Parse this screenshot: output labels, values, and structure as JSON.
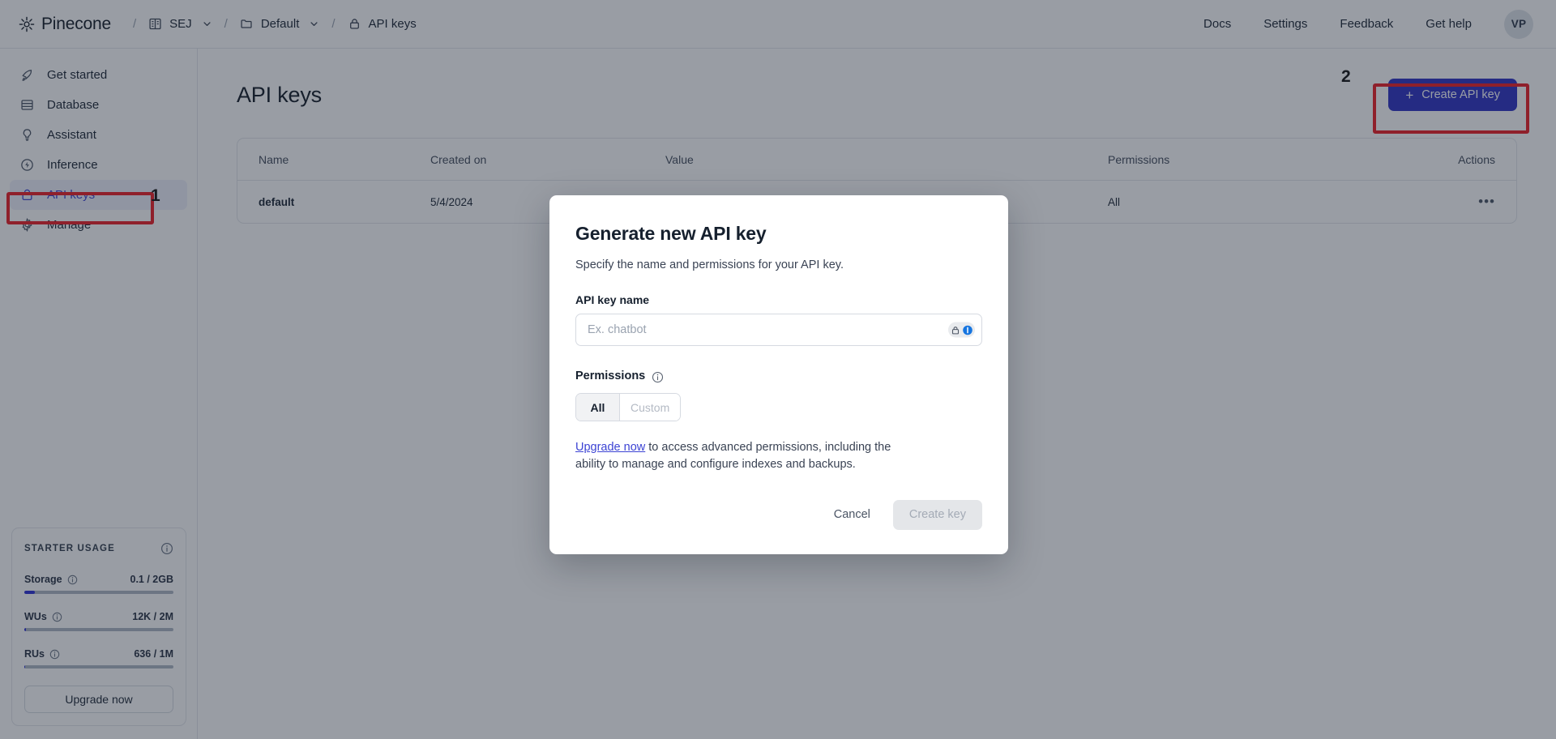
{
  "brand": {
    "name": "Pinecone",
    "logo_icon": "pinecone-logo-icon"
  },
  "breadcrumb": {
    "separator": "/",
    "items": [
      {
        "label": "SEJ",
        "icon": "organization-icon",
        "has_caret": true
      },
      {
        "label": "Default",
        "icon": "folder-icon",
        "has_caret": true
      },
      {
        "label": "API keys",
        "icon": "lock-icon",
        "has_caret": false
      }
    ]
  },
  "top_nav": {
    "links": [
      "Docs",
      "Settings",
      "Feedback",
      "Get help"
    ],
    "avatar_initials": "VP"
  },
  "sidebar": {
    "items": [
      {
        "label": "Get started",
        "icon": "rocket-icon",
        "active": false
      },
      {
        "label": "Database",
        "icon": "database-icon",
        "active": false
      },
      {
        "label": "Assistant",
        "icon": "lightbulb-icon",
        "active": false
      },
      {
        "label": "Inference",
        "icon": "bolt-circle-icon",
        "active": false
      },
      {
        "label": "API keys",
        "icon": "lock-icon",
        "active": true
      },
      {
        "label": "Manage",
        "icon": "gear-icon",
        "active": false
      }
    ],
    "usage": {
      "title": "STARTER USAGE",
      "info_icon": "info-icon",
      "metrics": [
        {
          "label": "Storage",
          "value": "0.1 / 2GB",
          "percent": 7
        },
        {
          "label": "WUs",
          "value": "12K / 2M",
          "percent": 1
        },
        {
          "label": "RUs",
          "value": "636 / 1M",
          "percent": 0.2
        }
      ],
      "upgrade_label": "Upgrade now"
    }
  },
  "main": {
    "title": "API keys",
    "create_button": {
      "label": "Create API key",
      "icon": "plus-icon"
    },
    "table": {
      "columns": [
        "Name",
        "Created on",
        "Value",
        "Permissions",
        "Actions"
      ],
      "rows": [
        {
          "name": "default",
          "created_on": "5/4/2024",
          "value": "",
          "permissions": "All",
          "actions": "•••"
        }
      ]
    }
  },
  "annotations": [
    {
      "number": "1",
      "target": "sidebar-item-api-keys"
    },
    {
      "number": "2",
      "target": "create-api-key-button"
    }
  ],
  "modal": {
    "title": "Generate new API key",
    "subtitle": "Specify the name and permissions for your API key.",
    "name_field": {
      "label": "API key name",
      "placeholder": "Ex. chatbot",
      "value": "",
      "badge_icons": [
        "password-lock-icon",
        "password-manager-icon"
      ]
    },
    "permissions": {
      "label": "Permissions",
      "info_icon": "info-icon",
      "options": [
        "All",
        "Custom"
      ],
      "selected": "All"
    },
    "upgrade_note": {
      "link_text": "Upgrade now",
      "rest_text": " to access advanced permissions, including the ability to manage and configure indexes and backups."
    },
    "actions": {
      "cancel_label": "Cancel",
      "submit_label": "Create key",
      "submit_disabled": true
    }
  },
  "colors": {
    "brand_primary": "#2d31c4",
    "accent_link": "#3c43d4",
    "annotation_red": "#ed1c24",
    "progress_fill": "#2b2fd6"
  }
}
